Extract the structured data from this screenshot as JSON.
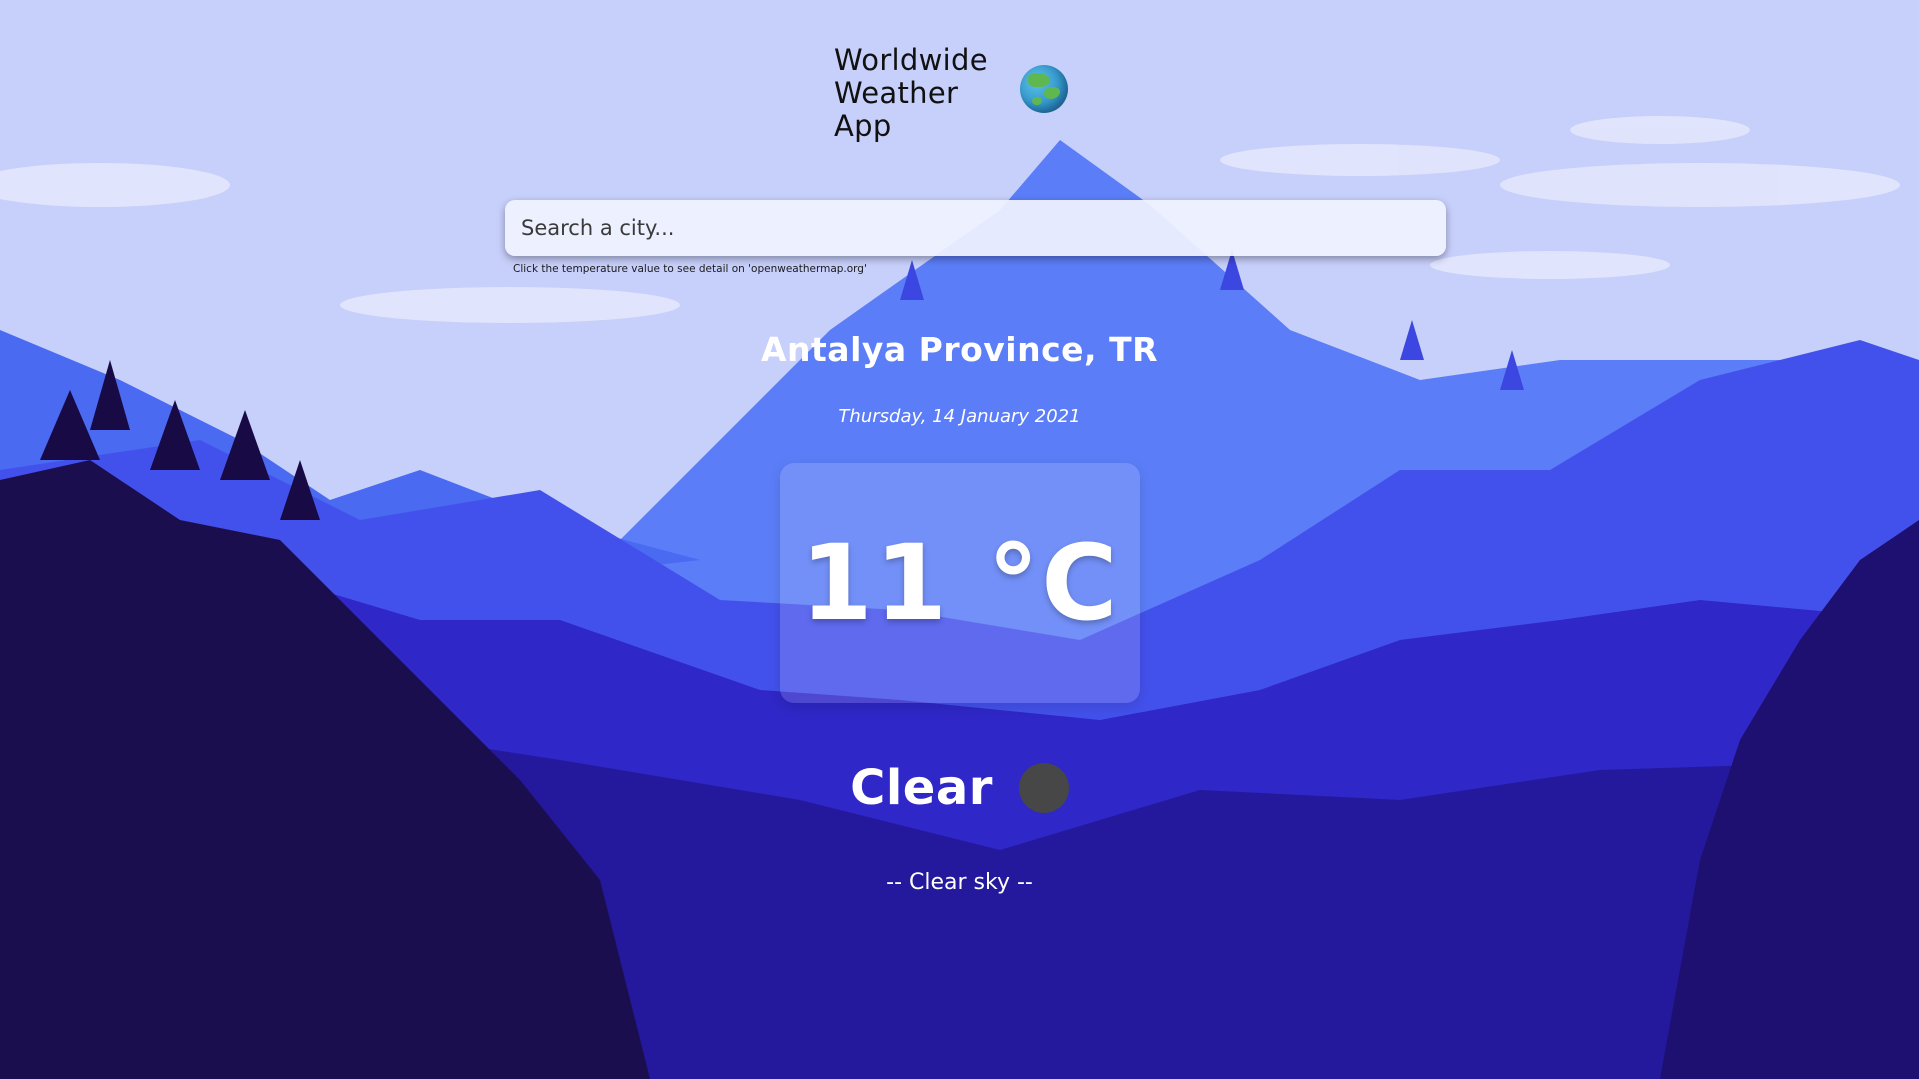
{
  "app": {
    "title_line1": "Worldwide",
    "title_line2": "Weather",
    "title_line3": "App",
    "logo_icon": "globe-icon"
  },
  "search": {
    "placeholder": "Search a city...",
    "value": "",
    "hint": "Click the temperature value to see detail on 'openweathermap.org'"
  },
  "weather": {
    "location": "Antalya Province, TR",
    "date": "Thursday, 14 January 2021",
    "temperature": "11 °C",
    "condition": "Clear",
    "condition_icon": "clear-sky-icon",
    "description": "-- Clear sky --"
  },
  "colors": {
    "sky": "#c7cffb",
    "mountain_far": "#5a7cf6",
    "mountain_mid": "#3c47e6",
    "mountain_near": "#261aa8",
    "forest_dark": "#1c0d5c",
    "text": "#ffffff"
  }
}
